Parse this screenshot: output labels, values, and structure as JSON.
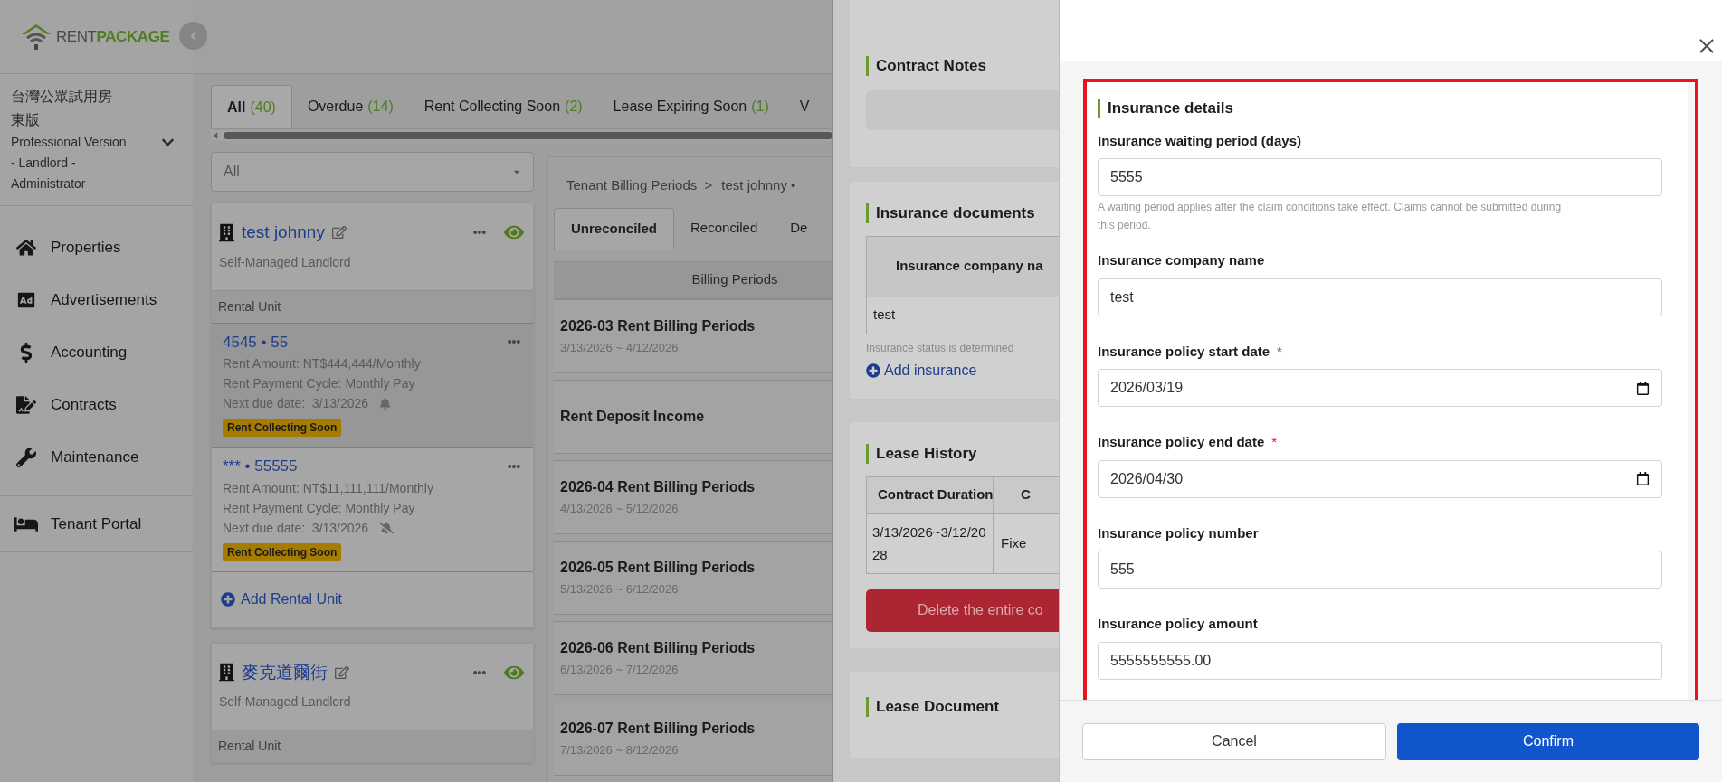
{
  "sidebar": {
    "logo": {
      "word1": "RENT",
      "word2": "PACKAGE"
    },
    "org": {
      "name": "台灣公眾試用房東版",
      "role": "Professional Version - Landlord - Administrator"
    },
    "nav": [
      {
        "label": "Properties"
      },
      {
        "label": "Advertisements"
      },
      {
        "label": "Accounting"
      },
      {
        "label": "Contracts"
      },
      {
        "label": "Maintenance"
      }
    ],
    "portal": {
      "label": "Tenant Portal"
    }
  },
  "status_tabs": [
    {
      "label": "All",
      "count": "(40)",
      "selected": true
    },
    {
      "label": "Overdue",
      "count": "(14)",
      "selected": false
    },
    {
      "label": "Rent Collecting Soon",
      "count": "(2)",
      "selected": false
    },
    {
      "label": "Lease Expiring Soon",
      "count": "(1)",
      "selected": false
    },
    {
      "label": "V",
      "selected": false
    }
  ],
  "filter": {
    "value": "All"
  },
  "properties": [
    {
      "name": "test johnny",
      "type": "Self-Managed Landlord",
      "section": "Rental Unit",
      "add_unit": "Add Rental Unit",
      "units": [
        {
          "title": "4545 • 55",
          "rent": "Rent Amount: NT$444,444/Monthly",
          "cycle": "Rent Payment Cycle: Monthly Pay",
          "due": "Next due date:  3/13/2026",
          "reminder": true,
          "badge": "Rent Collecting Soon",
          "selected": true
        },
        {
          "title": "*** • 55555",
          "rent": "Rent Amount: NT$11,111,111/Monthly",
          "cycle": "Rent Payment Cycle: Monthly Pay",
          "due": "Next due date:  3/13/2026",
          "reminder": false,
          "badge": "Rent Collecting Soon",
          "selected": false
        }
      ]
    },
    {
      "name": "麥克道爾街",
      "type": "Self-Managed Landlord",
      "section": "Rental Unit"
    }
  ],
  "billing": {
    "breadcrumb": "Tenant Billing Periods  >",
    "tenant": "test johnny •",
    "tabs": [
      {
        "label": "Unreconciled",
        "selected": true
      },
      {
        "label": "Reconciled",
        "selected": false
      },
      {
        "label": "De",
        "selected": false
      }
    ],
    "column": "Billing Periods",
    "rows": [
      {
        "title": "2026-03 Rent Billing Periods",
        "range": "3/13/2026 ~ 4/12/2026"
      },
      {
        "title": "Rent Deposit Income"
      },
      {
        "title": "2026-04 Rent Billing Periods",
        "range": "4/13/2026 ~ 5/12/2026"
      },
      {
        "title": "2026-05 Rent Billing Periods",
        "range": "5/13/2026 ~ 6/12/2026"
      },
      {
        "title": "2026-06 Rent Billing Periods",
        "range": "6/13/2026 ~ 7/12/2026"
      },
      {
        "title": "2026-07 Rent Billing Periods",
        "range": "7/13/2026 ~ 8/12/2026"
      }
    ]
  },
  "contract_drawer": {
    "notes": {
      "title": "Contract Notes"
    },
    "insurance": {
      "title": "Insurance documents",
      "column": "Insurance company na",
      "rows": [
        "test"
      ],
      "note": "Insurance status is determined",
      "add": "Add insurance"
    },
    "history": {
      "title": "Lease History",
      "columns": [
        "Contract Duration",
        "C"
      ],
      "rows": [
        [
          "3/13/2026~3/12/2028",
          "Fixe"
        ]
      ],
      "delete": "Delete the entire co"
    },
    "document": {
      "title": "Lease Document"
    }
  },
  "modal": {
    "section": "Insurance details",
    "fields": [
      {
        "label": "Insurance waiting period (days)",
        "kind": "text",
        "value": "5555",
        "help": "A waiting period applies after the claim conditions take effect. Claims cannot be submitted during this period."
      },
      {
        "label": "Insurance company name",
        "kind": "text",
        "value": "test"
      },
      {
        "label": "Insurance policy start date",
        "required_mark": "*",
        "kind": "date",
        "value": "2026/03/19"
      },
      {
        "label": "Insurance policy end date",
        "required_mark": "*",
        "kind": "date",
        "value": "2026/04/30"
      },
      {
        "label": "Insurance policy number",
        "kind": "text",
        "value": "555"
      },
      {
        "label": "Insurance policy amount",
        "kind": "text",
        "value": "5555555555.00"
      }
    ],
    "cancel": "Cancel",
    "confirm": "Confirm"
  }
}
